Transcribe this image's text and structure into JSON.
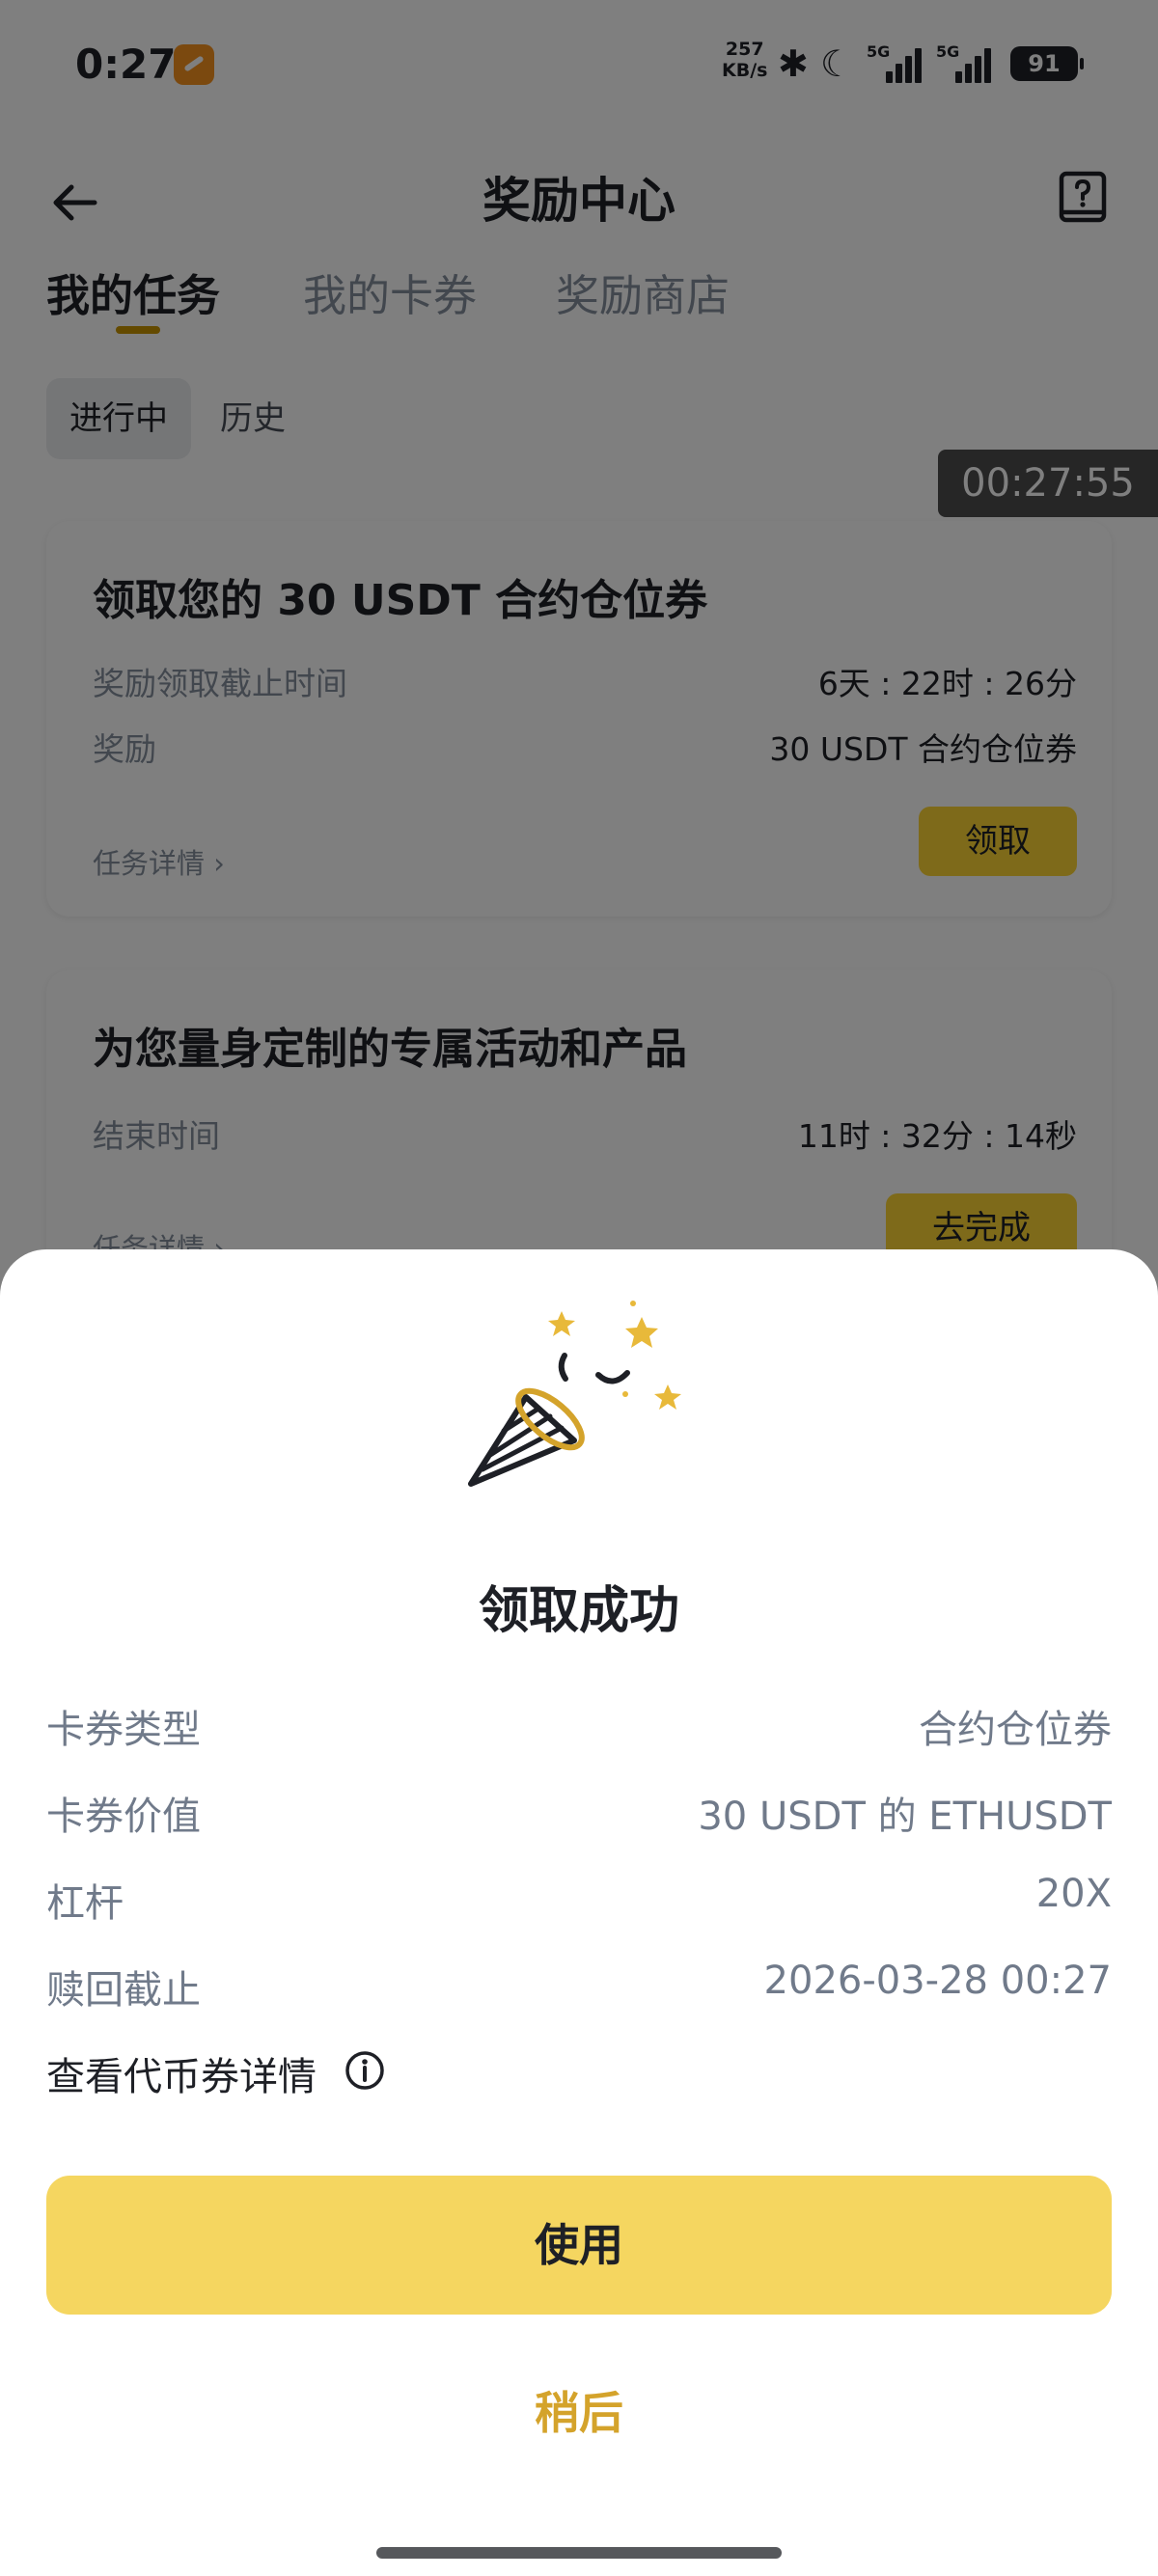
{
  "status_bar": {
    "time": "0:27",
    "net_speed_value": "257",
    "net_speed_unit": "KB/s",
    "signal_1_label": "5G",
    "signal_2_label": "5G",
    "battery": "91"
  },
  "header": {
    "title": "奖励中心"
  },
  "tabs": [
    {
      "label": "我的任务",
      "active": true
    },
    {
      "label": "我的卡券",
      "active": false
    },
    {
      "label": "奖励商店",
      "active": false
    }
  ],
  "subtabs": [
    {
      "label": "进行中",
      "active": true
    },
    {
      "label": "历史",
      "active": false
    }
  ],
  "timer_badge": "00:27:55",
  "task_cards": [
    {
      "title": "领取您的 30 USDT 合约仓位券",
      "rows": [
        {
          "label": "奖励领取截止时间",
          "value": "6天 : 22时 : 26分"
        },
        {
          "label": "奖励",
          "value": "30 USDT 合约仓位券"
        }
      ],
      "detail_link": "任务详情 ›",
      "button": "领取"
    },
    {
      "title": "为您量身定制的专属活动和产品",
      "rows": [
        {
          "label": "结束时间",
          "value": "11时 : 32分 : 14秒"
        }
      ],
      "detail_link": "任务详情 ›",
      "button": "去完成"
    }
  ],
  "sheet": {
    "title": "领取成功",
    "details": [
      {
        "label": "卡券类型",
        "value": "合约仓位券"
      },
      {
        "label": "卡券价值",
        "value": "30 USDT 的 ETHUSDT"
      },
      {
        "label": "杠杆",
        "value": "20X"
      },
      {
        "label": "赎回截止",
        "value": "2026-03-28 00:27"
      }
    ],
    "coupon_details_link": "查看代币券详情",
    "use_button": "使用",
    "later_button": "稍后"
  },
  "colors": {
    "accent_yellow": "#F5D660",
    "later_text": "#D4A32B",
    "tab_indicator": "#C99400",
    "overlay": "rgba(0,0,0,0.5)"
  },
  "icons": [
    "back-arrow-icon",
    "help-book-icon",
    "bluetooth-icon",
    "moon-icon",
    "party-popper-icon",
    "info-circle-icon"
  ]
}
